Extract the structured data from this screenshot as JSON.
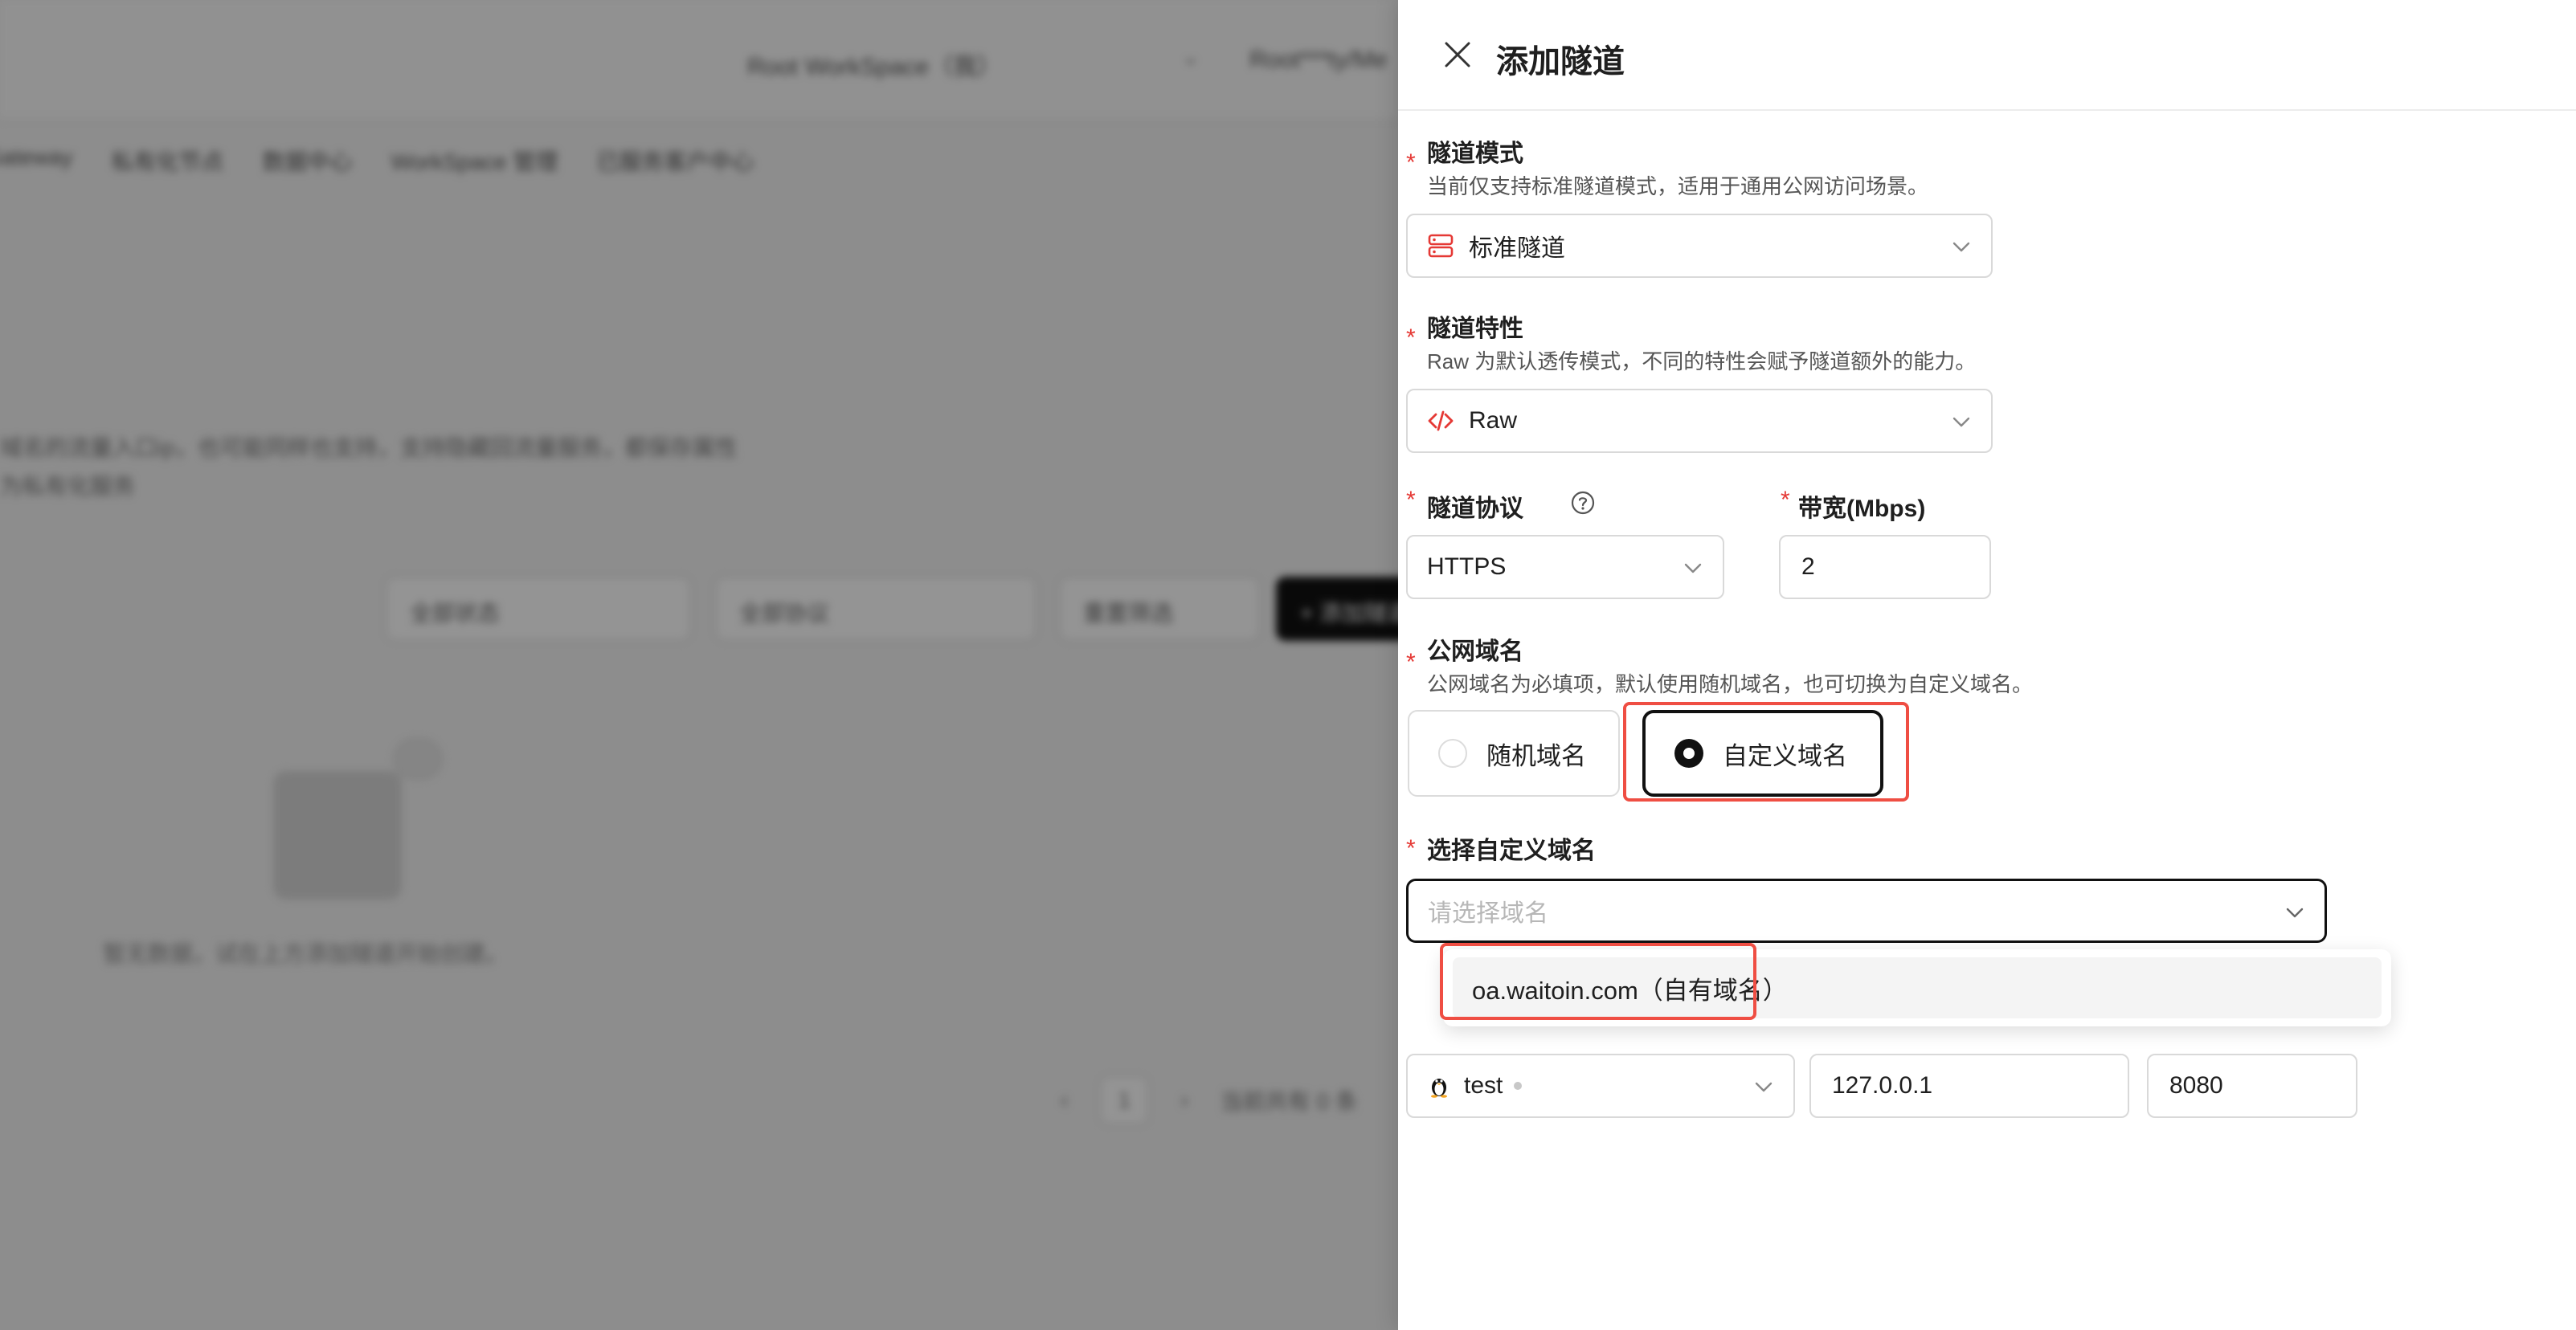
{
  "background": {
    "workspace_label": "Root WorkSpace（我）",
    "user_label": "Root***ty/Me",
    "nav_items": [
      "Gateway",
      "私有化节点",
      "数据中心",
      "WorkSpace 管理",
      "已服务客户中心"
    ],
    "desc_line1": "域名的流量入口ip，也可能同样也支持，支持隐藏回流量服务，都保存属性",
    "desc_line2": "为私有化服务",
    "filter1": "全部状态",
    "filter2": "全部协议",
    "filter3": "重置筛选",
    "filter4": "+ 添加隧道",
    "empty_text": "暂无数据，试在上方添加隧道开始创建。",
    "pager_page": "1",
    "pager_info": "当前共有 0 条"
  },
  "drawer": {
    "title": "添加隧道",
    "required_mark": "*",
    "tunnel_mode": {
      "label": "隧道模式",
      "hint": "当前仅支持标准隧道模式，适用于通用公网访问场景。",
      "value": "标准隧道"
    },
    "tunnel_feature": {
      "label": "隧道特性",
      "hint": "Raw 为默认透传模式，不同的特性会赋予隧道额外的能力。",
      "value": "Raw"
    },
    "protocol": {
      "label": "隧道协议",
      "value": "HTTPS"
    },
    "bandwidth": {
      "label": "带宽(Mbps)",
      "value": "2"
    },
    "public_domain": {
      "label": "公网域名",
      "hint": "公网域名为必填项，默认使用随机域名，也可切换为自定义域名。",
      "options": [
        "随机域名",
        "自定义域名"
      ],
      "selected": "自定义域名"
    },
    "custom_domain": {
      "label": "选择自定义域名",
      "placeholder": "请选择域名",
      "dropdown_option": "oa.waitoin.com（自有域名）"
    },
    "node": {
      "value": "test"
    },
    "target_ip": {
      "value": "127.0.0.1"
    },
    "target_port": {
      "value": "8080"
    }
  },
  "colors": {
    "required": "#e53935",
    "highlight_box": "#ef4e43",
    "selected_border": "#111111",
    "icon_red": "#e53935"
  }
}
